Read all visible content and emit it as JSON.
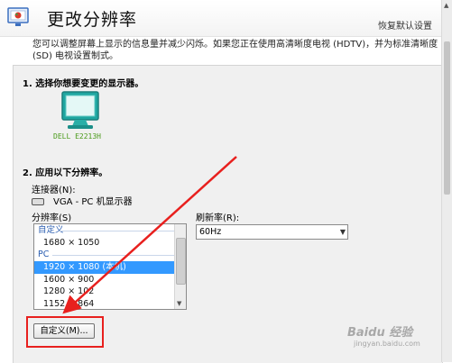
{
  "header": {
    "title": "更改分辨率",
    "restore_label": "恢复默认设置"
  },
  "description": "您可以调整屏幕上显示的信息量并减少闪烁。如果您正在使用高清晰度电视 (HDTV)，并为标准清晰度 (SD) 电视设置制式。",
  "step1": {
    "heading": "1. 选择你想要变更的显示器。",
    "monitor_name": "DELL E2213H"
  },
  "step2": {
    "heading": "2. 应用以下分辨率。",
    "connector_label": "连接器(N):",
    "connector_value": "VGA - PC 机显示器",
    "resolution_label": "分辨率(S)",
    "refresh_label": "刷新率(R):",
    "refresh_value": "60Hz",
    "list": {
      "group_custom": "自定义",
      "custom_items": [
        "1680 × 1050"
      ],
      "group_pc": "PC",
      "pc_items": [
        "1920 × 1080 (本机)",
        "1600 × 900",
        "1280 × 102",
        "1152 × 864"
      ],
      "selected": "1920 × 1080 (本机)"
    },
    "custom_button": "自定义(M)..."
  },
  "watermark": {
    "brand": "Baidu 经验",
    "url": "jingyan.baidu.com"
  },
  "colors": {
    "highlight_red": "#e8201e",
    "selection_blue": "#3399ff",
    "monitor_green": "#4a9a1a"
  }
}
